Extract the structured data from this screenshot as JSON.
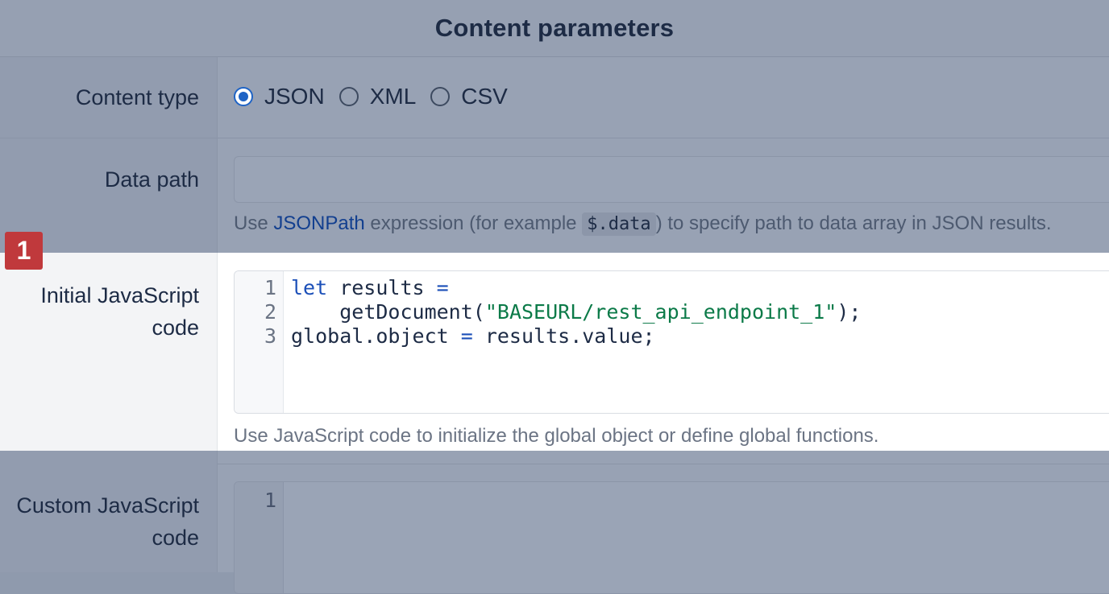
{
  "header": {
    "title": "Content parameters"
  },
  "content_type": {
    "label": "Content type",
    "options": [
      {
        "label": "JSON",
        "checked": true
      },
      {
        "label": "XML",
        "checked": false
      },
      {
        "label": "CSV",
        "checked": false
      }
    ]
  },
  "data_path": {
    "label": "Data path",
    "value": "",
    "placeholder": "",
    "help_prefix": "Use ",
    "help_link": "JSONPath",
    "help_middle": " expression (for example ",
    "help_code": "$.data",
    "help_suffix": ") to specify path to data array in JSON results."
  },
  "initial_js": {
    "badge": "1",
    "label_line1": "Initial JavaScript",
    "label_line2": "code",
    "line_numbers": [
      "1",
      "2",
      "3"
    ],
    "code": {
      "l1_kw": "let",
      "l1_rest": " results ",
      "l1_op": "=",
      "l2_indent": "    ",
      "l2_fn": "getDocument(",
      "l2_str": "\"BASEURL/rest_api_endpoint_1\"",
      "l2_end": ");",
      "l3_a": "global.object ",
      "l3_op": "=",
      "l3_b": " results.value;"
    },
    "help": "Use JavaScript code to initialize the global object or define global functions."
  },
  "custom_js": {
    "label_line1": "Custom JavaScript",
    "label_line2": "code",
    "line_numbers": [
      "1"
    ]
  }
}
